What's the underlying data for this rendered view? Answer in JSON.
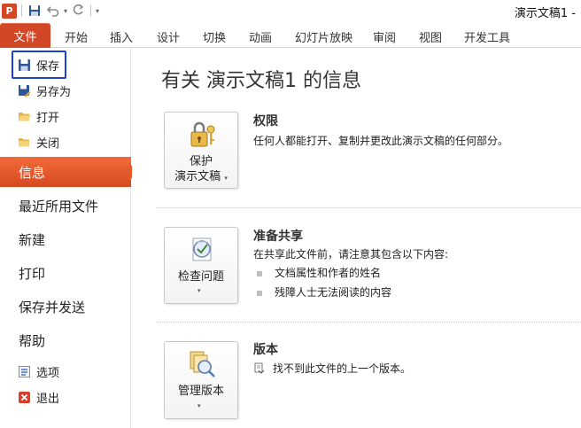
{
  "title_bar": {
    "app_icon_letter": "P",
    "document_title": "演示文稿1 -",
    "qat_icons": [
      "save-icon",
      "undo-icon",
      "redo-icon",
      "customize-qat-icon"
    ]
  },
  "ribbon_tabs": {
    "file": "文件",
    "items": [
      "开始",
      "插入",
      "设计",
      "切换",
      "动画",
      "幻灯片放映",
      "审阅",
      "视图",
      "开发工具"
    ]
  },
  "backstage_menu": {
    "small_items": [
      "保存",
      "另存为",
      "打开",
      "关闭"
    ],
    "selected": "信息",
    "large_items": [
      "最近所用文件",
      "新建",
      "打印",
      "保存并发送",
      "帮助"
    ],
    "bottom_items": [
      "选项",
      "退出"
    ]
  },
  "info_panel": {
    "heading": "有关 演示文稿1 的信息",
    "sections": [
      {
        "button_lines": [
          "保护",
          "演示文稿"
        ],
        "title": "权限",
        "description": "任何人都能打开、复制并更改此演示文稿的任何部分。"
      },
      {
        "button_lines": [
          "检查问题"
        ],
        "title": "准备共享",
        "description": "在共享此文件前，请注意其包含以下内容:",
        "bullets": [
          "文档属性和作者的姓名",
          "残障人士无法阅读的内容"
        ]
      },
      {
        "button_lines": [
          "管理版本"
        ],
        "title": "版本",
        "description": "找不到此文件的上一个版本。"
      }
    ]
  },
  "colors": {
    "accent": "#d24726",
    "selected_menu": "#e35a2c",
    "highlight_box": "#1f3fd0"
  }
}
